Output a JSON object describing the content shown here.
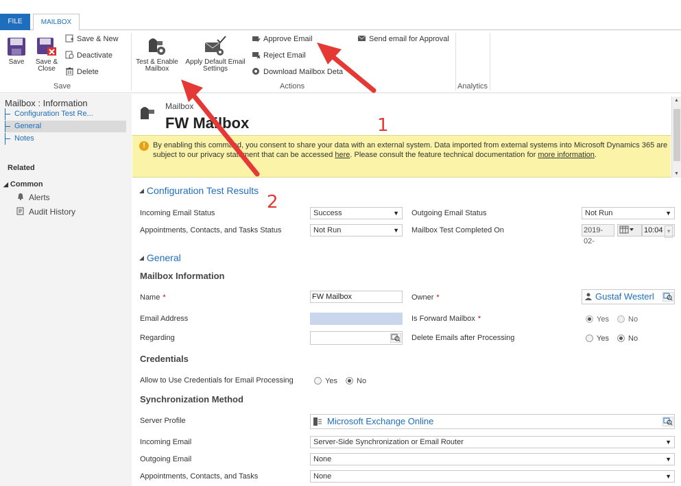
{
  "tabs": {
    "file": "FILE",
    "mailbox": "MAILBOX"
  },
  "ribbon": {
    "save": "Save",
    "save_close": "Save & Close",
    "save_new": "Save & New",
    "deactivate": "Deactivate",
    "delete": "Delete",
    "test_enable": "Test & Enable Mailbox",
    "apply_default": "Apply Default Email Settings",
    "approve_email": "Approve Email",
    "reject_email": "Reject Email",
    "download_mailbox": "Download Mailbox Deta",
    "send_email_approval": "Send email for Approval",
    "group_save": "Save",
    "group_actions": "Actions",
    "group_analytics": "Analytics"
  },
  "nav": {
    "title": "Mailbox : Information",
    "items": [
      "Configuration Test Re...",
      "General",
      "Notes"
    ],
    "related": "Related",
    "common": "Common",
    "links": [
      "Alerts",
      "Audit History"
    ]
  },
  "header": {
    "entity": "Mailbox",
    "title": "FW Mailbox"
  },
  "notice": {
    "text_before": "By enabling this command, you consent to share your data with an external system. Data imported from external systems into Microsoft Dynamics 365 are subject to our privacy statement that can be accessed ",
    "link1": "here",
    "text_mid": ". Please consult the feature technical documentation for ",
    "link2": "more information",
    "text_end": "."
  },
  "config": {
    "section": "Configuration Test Results",
    "incoming_label": "Incoming Email Status",
    "incoming_value": "Success",
    "outgoing_label": "Outgoing Email Status",
    "outgoing_value": "Not Run",
    "act_label": "Appointments, Contacts, and Tasks Status",
    "act_value": "Not Run",
    "completed_label": "Mailbox Test Completed On",
    "completed_date": "2019-02-",
    "completed_time": "10:04"
  },
  "general": {
    "section": "General",
    "mailbox_info": "Mailbox Information",
    "name_label": "Name",
    "name_value": "FW Mailbox",
    "owner_label": "Owner",
    "owner_value": "Gustaf Westerl",
    "email_label": "Email Address",
    "forward_label": "Is Forward Mailbox",
    "regarding_label": "Regarding",
    "delete_label": "Delete Emails after Processing",
    "yes": "Yes",
    "no": "No",
    "credentials": "Credentials",
    "allow_label": "Allow to Use Credentials for Email Processing",
    "sync": "Synchronization Method",
    "server_label": "Server Profile",
    "server_value": "Microsoft Exchange Online",
    "incoming_email_label": "Incoming Email",
    "incoming_email_value": "Server-Side Synchronization or Email Router",
    "outgoing_email_label": "Outgoing Email",
    "outgoing_email_value": "None",
    "act_email_label": "Appointments, Contacts, and Tasks",
    "act_email_value": "None"
  },
  "annotations": {
    "one": "1",
    "two": "2",
    "arrow_color": "#e53935"
  },
  "colors": {
    "accent": "#1f6ebd",
    "notice_bg": "#fbf3a8"
  }
}
